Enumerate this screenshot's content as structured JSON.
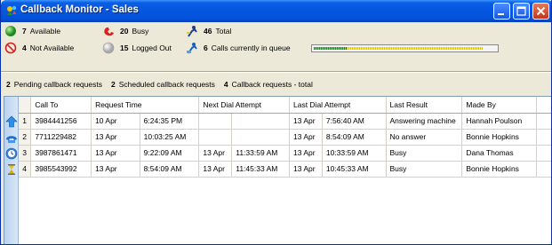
{
  "window": {
    "title": "Callback Monitor - Sales",
    "icon": "callback-app-icon",
    "buttons": [
      "minimize-icon",
      "maximize-icon",
      "close-icon"
    ]
  },
  "stats": {
    "available": {
      "value": "7",
      "label": "Available",
      "icon": "green-circle-icon"
    },
    "busy": {
      "value": "20",
      "label": "Busy",
      "icon": "red-phone-icon"
    },
    "total": {
      "value": "46",
      "label": "Total",
      "icon": "agents-icon"
    },
    "not_available": {
      "value": "4",
      "label": "Not Available",
      "icon": "no-entry-icon"
    },
    "logged_out": {
      "value": "15",
      "label": "Logged Out",
      "icon": "grey-circle-icon"
    },
    "queue": {
      "value": "6",
      "label": "Calls currently in queue",
      "icon": "queue-icon"
    }
  },
  "queue_bar": {
    "green_fraction": 0.18,
    "yellow_fraction": 0.74,
    "colors": {
      "green": "#1b8a1b",
      "yellow": "#d9c200"
    }
  },
  "summary": {
    "pending": {
      "value": "2",
      "label": "Pending callback requests"
    },
    "scheduled": {
      "value": "2",
      "label": "Scheduled callback requests"
    },
    "total": {
      "value": "4",
      "label": "Callback requests - total"
    }
  },
  "table": {
    "headers": [
      "Call To",
      "Request Time",
      "Next Dial Attempt",
      "Last Dial Attempt",
      "Last Result",
      "Made By"
    ],
    "rows": [
      {
        "num": "1",
        "icon": "arrow-up-icon",
        "call_to": "3984441256",
        "req_date": "10 Apr",
        "req_time": "6:24:35 PM",
        "next_date": "",
        "next_time": "",
        "last_date": "13 Apr",
        "last_time": "7:56:40 AM",
        "result": "Answering machine",
        "made_by": "Hannah Poulson"
      },
      {
        "num": "2",
        "icon": "phone-ringing-icon",
        "call_to": "7711229482",
        "req_date": "13 Apr",
        "req_time": "10:03:25 AM",
        "next_date": "",
        "next_time": "",
        "last_date": "13 Apr",
        "last_time": "8:54:09 AM",
        "result": "No answer",
        "made_by": "Bonnie Hopkins"
      },
      {
        "num": "3",
        "icon": "clock-icon",
        "call_to": "3987861471",
        "req_date": "13 Apr",
        "req_time": "9:22:09 AM",
        "next_date": "13 Apr",
        "next_time": "11:33:59 AM",
        "last_date": "13 Apr",
        "last_time": "10:33:59 AM",
        "result": "Busy",
        "made_by": "Dana Thomas"
      },
      {
        "num": "4",
        "icon": "hourglass-icon",
        "call_to": "3985543992",
        "req_date": "13 Apr",
        "req_time": "8:54:09 AM",
        "next_date": "13 Apr",
        "next_time": "11:45:33 AM",
        "last_date": "13 Apr",
        "last_time": "10:45:33 AM",
        "result": "Busy",
        "made_by": "Bonnie Hopkins"
      }
    ]
  }
}
